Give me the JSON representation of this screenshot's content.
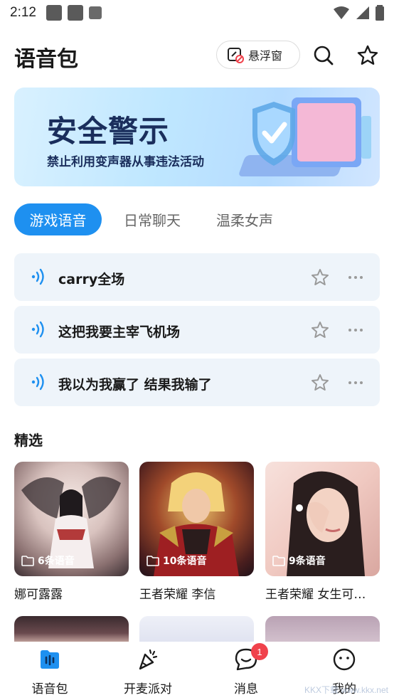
{
  "status_bar": {
    "time": "2:12"
  },
  "header": {
    "title": "语音包",
    "float_window_label": "悬浮窗"
  },
  "banner": {
    "title": "安全警示",
    "subtitle": "禁止利用变声器从事违法活动"
  },
  "tabs": [
    {
      "label": "游戏语音",
      "active": true
    },
    {
      "label": "日常聊天",
      "active": false
    },
    {
      "label": "温柔女声",
      "active": false
    }
  ],
  "voices": [
    {
      "text": "carry全场"
    },
    {
      "text": "这把我要主宰飞机场"
    },
    {
      "text": "我以为我赢了 结果我输了"
    }
  ],
  "selected": {
    "title": "精选",
    "cards": [
      {
        "name": "娜可露露",
        "count": "6条语音"
      },
      {
        "name": "王者荣耀 李信",
        "count": "10条语音"
      },
      {
        "name": "王者荣耀 女生可…",
        "count": "9条语音"
      }
    ]
  },
  "bottom_nav": {
    "items": [
      {
        "label": "语音包",
        "icon": "voice-pack-icon",
        "active": true
      },
      {
        "label": "开麦派对",
        "icon": "party-icon"
      },
      {
        "label": "消息",
        "icon": "message-icon",
        "badge": "1"
      },
      {
        "label": "我的",
        "icon": "profile-icon"
      }
    ]
  },
  "colors": {
    "accent": "#1e90f0",
    "voice_bg": "#eef4fa",
    "badge": "#f0424c"
  },
  "watermark": "KKX下载 www.kkx.net"
}
